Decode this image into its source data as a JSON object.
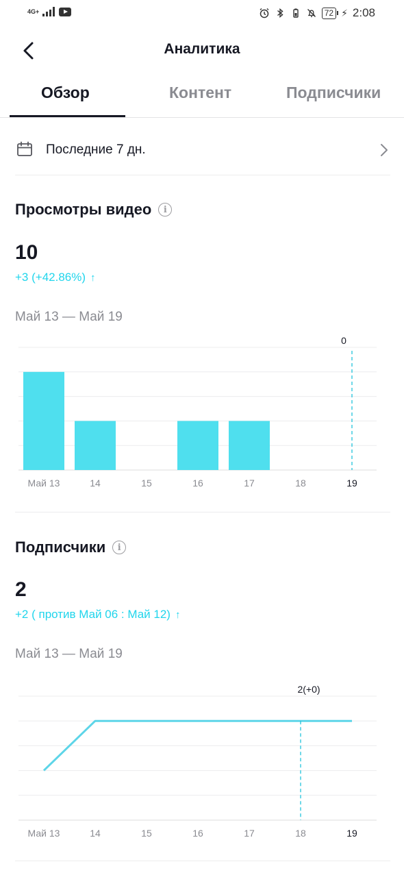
{
  "status_bar": {
    "network": "4G+",
    "time": "2:08",
    "battery": "72"
  },
  "header": {
    "title": "Аналитика"
  },
  "tabs": [
    {
      "label": "Обзор",
      "active": true
    },
    {
      "label": "Контент",
      "active": false
    },
    {
      "label": "Подписчики",
      "active": false
    }
  ],
  "range": {
    "label": "Последние 7 дн."
  },
  "views": {
    "title": "Просмотры видео",
    "value": "10",
    "delta": "+3 (+42.86%)",
    "date_range": "Май 13 — Май 19"
  },
  "followers": {
    "title": "Подписчики",
    "value": "2",
    "delta": "+2 ( против Май 06 : Май 12)",
    "date_range": "Май 13 — Май 19"
  },
  "colors": {
    "accent": "#20d5ec",
    "bar": "#4fdfee",
    "line": "#5dd5e8"
  },
  "chart_data": [
    {
      "type": "bar",
      "categories": [
        "Май 13",
        "14",
        "15",
        "16",
        "17",
        "18",
        "19"
      ],
      "values": [
        4,
        2,
        0,
        2,
        2,
        0,
        0
      ],
      "ylim": [
        0,
        5
      ],
      "grid": true,
      "selected_index": 6,
      "selected_label": "0"
    },
    {
      "type": "line",
      "categories": [
        "Май 13",
        "14",
        "15",
        "16",
        "17",
        "18",
        "19"
      ],
      "values": [
        1,
        2,
        2,
        2,
        2,
        2,
        2
      ],
      "ylim": [
        0,
        2.5
      ],
      "grid": true,
      "selected_index": 5,
      "selected_label": "2(+0)"
    }
  ]
}
